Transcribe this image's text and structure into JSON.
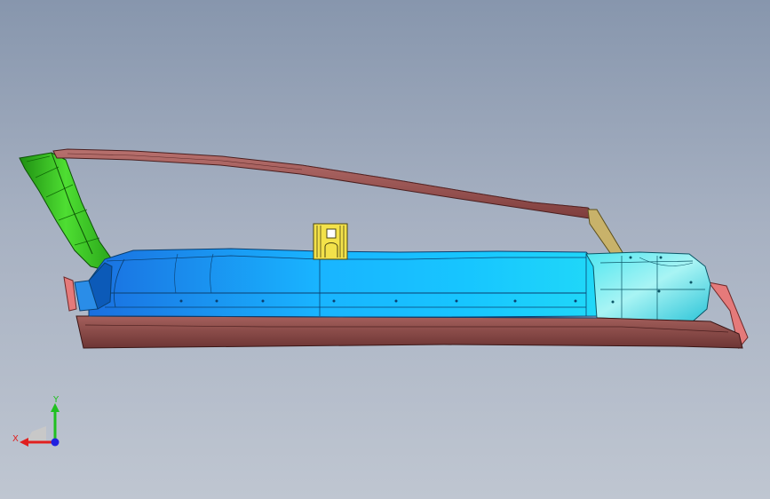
{
  "viewport": {
    "background_top": "#8796ad",
    "background_bottom": "#bfc6d1"
  },
  "model": {
    "parts": [
      {
        "name": "roof-rail",
        "color": "#9a4f4f"
      },
      {
        "name": "a-pillar",
        "color": "#2fbf1c"
      },
      {
        "name": "door-inner-panel",
        "color": "#1ea8ff"
      },
      {
        "name": "rear-panel",
        "color": "#3fe3e6"
      },
      {
        "name": "rocker-sill",
        "color": "#8f4a48"
      },
      {
        "name": "c-pillar-bracket",
        "color": "#c8b26a"
      },
      {
        "name": "latch-bracket",
        "color": "#f3e24a"
      },
      {
        "name": "rear-trim",
        "color": "#e57a7a"
      }
    ]
  },
  "triad": {
    "x_label": "X",
    "y_label": "Y",
    "x_color": "#e02020",
    "y_color": "#20c020",
    "z_color": "#2020e0"
  }
}
